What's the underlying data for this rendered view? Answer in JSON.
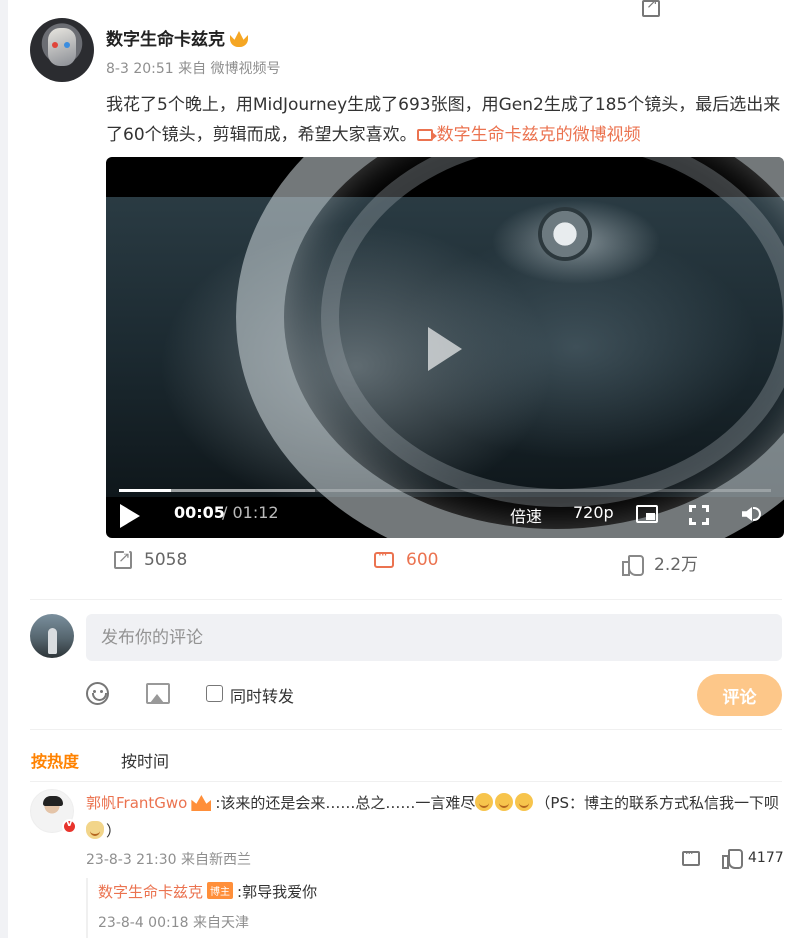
{
  "post": {
    "author_name": "数字生命卡兹克",
    "meta": "8-3 20:51 来自 微博视频号",
    "text_main": "我花了5个晚上，用MidJourney生成了693张图，用Gen2生成了185个镜头，最后选出来了60个镜头，剪辑而成，希望大家喜欢。",
    "video_link_label": "数字生命卡兹克的微博视频"
  },
  "video": {
    "current_time": "00:05",
    "separator": " / ",
    "total_time": "01:12",
    "speed_label": "倍速",
    "quality_label": "720p",
    "progress_played_pct": 8,
    "progress_buffered_pct": 30
  },
  "actions": {
    "share_count": "5058",
    "comment_count": "600",
    "like_count": "2.2万"
  },
  "composer": {
    "placeholder": "发布你的评论",
    "repost_label": "同时转发",
    "submit_label": "评论"
  },
  "sort": {
    "hot_label": "按热度",
    "time_label": "按时间"
  },
  "comments": [
    {
      "name": "郭帆FrantGwo",
      "text_1": ":该来的还是会来……总之……一言难尽",
      "text_2": "（PS：博主的联系方式私信我一下呗",
      "text_3": "）",
      "meta": "23-8-3 21:30 来自新西兰",
      "like_count": "4177",
      "reply": {
        "name": "数字生命卡兹克",
        "badge": "博主",
        "text": ":郭导我爱你",
        "meta": "23-8-4 00:18 来自天津"
      }
    }
  ],
  "colors": {
    "accent": "#eb7350",
    "hot_sort": "#ff8200",
    "submit_bg": "#fdc789"
  }
}
